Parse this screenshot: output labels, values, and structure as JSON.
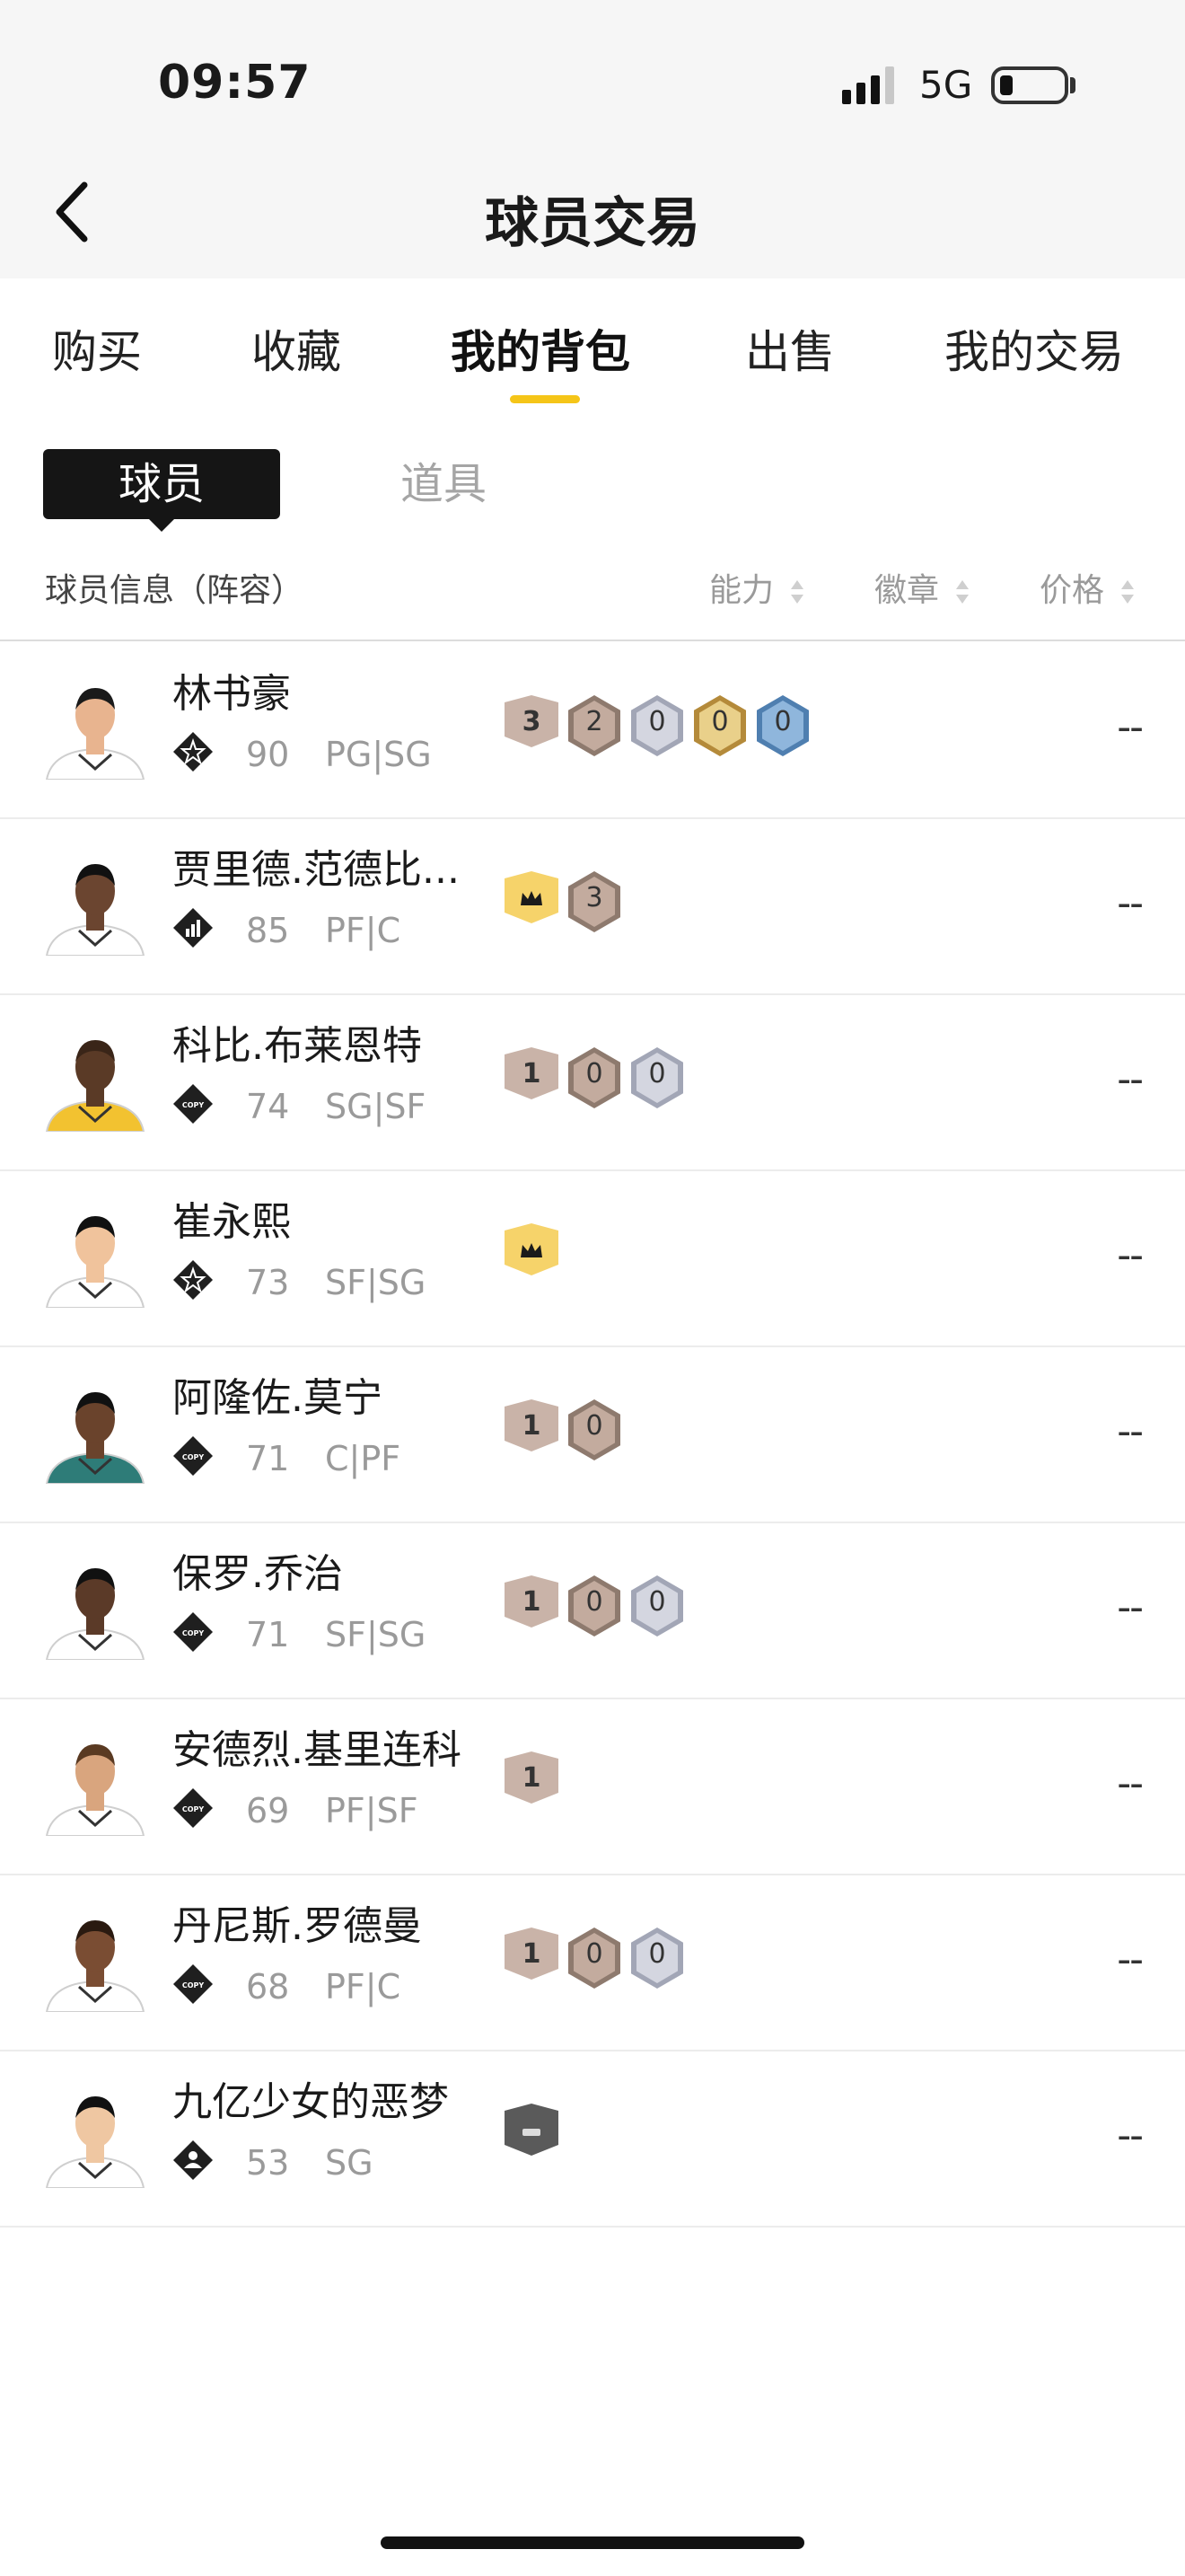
{
  "status_bar": {
    "time": "09:57",
    "network": "5G",
    "battery_icon": "battery-low-icon"
  },
  "header": {
    "title": "球员交易",
    "back_icon": "chevron-left-icon"
  },
  "tabs": [
    {
      "label": "购买",
      "active": false
    },
    {
      "label": "收藏",
      "active": false
    },
    {
      "label": "我的背包",
      "active": true
    },
    {
      "label": "出售",
      "active": false
    },
    {
      "label": "我的交易",
      "active": false
    }
  ],
  "segments": {
    "active": "球员",
    "other": "道具"
  },
  "columns": {
    "info": "球员信息（阵容）",
    "ability": "能力",
    "badge": "徽章",
    "price": "价格"
  },
  "colors": {
    "accent": "#f5c518"
  },
  "players": [
    {
      "name": "林书豪",
      "tier_icon": "star-tier-icon",
      "ovr": "90",
      "pos": "PG|SG",
      "price": "--",
      "badges": [
        {
          "kind": "level",
          "text": "3"
        },
        {
          "kind": "bronze",
          "text": "2"
        },
        {
          "kind": "silver",
          "text": "0"
        },
        {
          "kind": "gold",
          "text": "0"
        },
        {
          "kind": "blue",
          "text": "0"
        }
      ]
    },
    {
      "name": "贾里德.范德比...",
      "tier_icon": "bars-tier-icon",
      "ovr": "85",
      "pos": "PF|C",
      "price": "--",
      "badges": [
        {
          "kind": "crown",
          "text": ""
        },
        {
          "kind": "bronze",
          "text": "3"
        }
      ]
    },
    {
      "name": "科比.布莱恩特",
      "tier_icon": "copy-tier-icon",
      "ovr": "74",
      "pos": "SG|SF",
      "price": "--",
      "badges": [
        {
          "kind": "level",
          "text": "1"
        },
        {
          "kind": "bronze",
          "text": "0"
        },
        {
          "kind": "silver",
          "text": "0"
        }
      ]
    },
    {
      "name": "崔永熙",
      "tier_icon": "star-tier-icon",
      "ovr": "73",
      "pos": "SF|SG",
      "price": "--",
      "badges": [
        {
          "kind": "crown",
          "text": ""
        }
      ]
    },
    {
      "name": "阿隆佐.莫宁",
      "tier_icon": "copy-tier-icon",
      "ovr": "71",
      "pos": "C|PF",
      "price": "--",
      "badges": [
        {
          "kind": "level",
          "text": "1"
        },
        {
          "kind": "bronze",
          "text": "0"
        }
      ]
    },
    {
      "name": "保罗.乔治",
      "tier_icon": "copy-tier-icon",
      "ovr": "71",
      "pos": "SF|SG",
      "price": "--",
      "badges": [
        {
          "kind": "level",
          "text": "1"
        },
        {
          "kind": "bronze",
          "text": "0"
        },
        {
          "kind": "silver",
          "text": "0"
        }
      ]
    },
    {
      "name": "安德烈.基里连科",
      "tier_icon": "copy-tier-icon",
      "ovr": "69",
      "pos": "PF|SF",
      "price": "--",
      "badges": [
        {
          "kind": "level",
          "text": "1"
        }
      ]
    },
    {
      "name": "丹尼斯.罗德曼",
      "tier_icon": "copy-tier-icon",
      "ovr": "68",
      "pos": "PF|C",
      "price": "--",
      "badges": [
        {
          "kind": "level",
          "text": "1"
        },
        {
          "kind": "bronze",
          "text": "0"
        },
        {
          "kind": "silver",
          "text": "0"
        }
      ]
    },
    {
      "name": "九亿少女的恶梦",
      "tier_icon": "person-tier-icon",
      "ovr": "53",
      "pos": "SG",
      "price": "--",
      "badges": [
        {
          "kind": "dash",
          "text": ""
        }
      ]
    }
  ]
}
